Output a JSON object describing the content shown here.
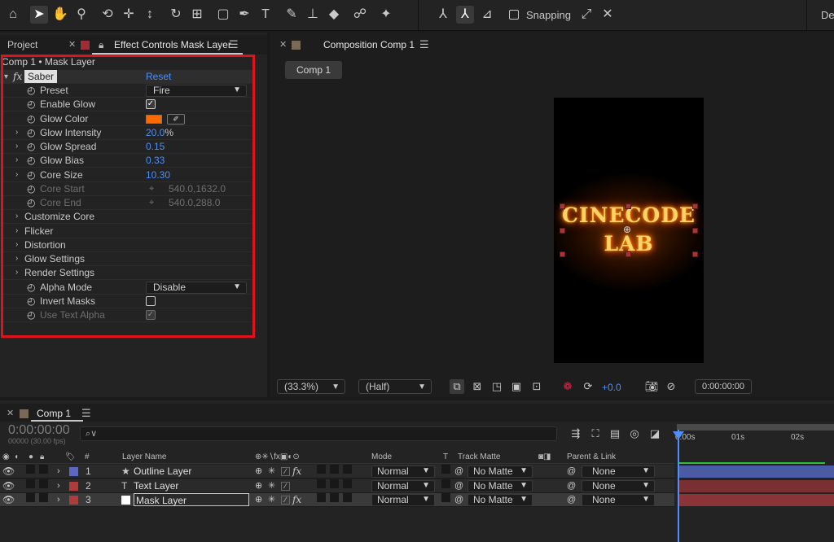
{
  "toolbar": {
    "tools": [
      "home-icon",
      "selection-icon",
      "hand-icon",
      "zoom-icon",
      "orbit-camera-icon",
      "pan-camera-icon",
      "dolly-camera-icon",
      "rotation-icon",
      "anchor-point-icon",
      "rectangle-icon",
      "pen-icon",
      "type-icon",
      "brush-icon",
      "clone-stamp-icon",
      "eraser-icon",
      "roto-brush-icon",
      "puppet-pin-icon"
    ],
    "snapping_label": "Snapping",
    "workspace_label": "De"
  },
  "effect_controls": {
    "tab_project": "Project",
    "tab_effect": "Effect Controls Mask Layer",
    "layer_path": "Comp 1 • Mask Layer",
    "effect_name": "Saber",
    "reset": "Reset",
    "fx": "fx",
    "properties": [
      {
        "name": "Preset",
        "kind": "dropdown",
        "value": "Fire"
      },
      {
        "name": "Enable Glow",
        "kind": "checkbox",
        "value": "✓"
      },
      {
        "name": "Glow Color",
        "kind": "color",
        "value": "#ff6a00"
      },
      {
        "name": "Glow Intensity",
        "kind": "number",
        "value": "20.0",
        "suffix": "%"
      },
      {
        "name": "Glow Spread",
        "kind": "number",
        "value": "0.15"
      },
      {
        "name": "Glow Bias",
        "kind": "number",
        "value": "0.33"
      },
      {
        "name": "Core Size",
        "kind": "number",
        "value": "10.30"
      },
      {
        "name": "Core Start",
        "kind": "point",
        "value": "540.0,1632.0"
      },
      {
        "name": "Core End",
        "kind": "point",
        "value": "540.0,288.0"
      },
      {
        "name": "Customize Core",
        "kind": "group"
      },
      {
        "name": "Flicker",
        "kind": "group"
      },
      {
        "name": "Distortion",
        "kind": "group"
      },
      {
        "name": "Glow Settings",
        "kind": "group"
      },
      {
        "name": "Render Settings",
        "kind": "group"
      },
      {
        "name": "Alpha Mode",
        "kind": "dropdown",
        "value": "Disable"
      },
      {
        "name": "Invert Masks",
        "kind": "checkbox",
        "value": ""
      },
      {
        "name": "Use Text Alpha",
        "kind": "checkbox",
        "value": "✓"
      }
    ]
  },
  "composition": {
    "tab": "Composition Comp 1",
    "chip": "Comp 1",
    "text_line1": "CINECODE",
    "text_line2": "LAB",
    "zoom": "(33.3%)",
    "resolution": "(Half)",
    "exposure": "+0.0",
    "time": "0:00:00:00"
  },
  "timeline": {
    "tab": "Comp 1",
    "current_time": "0:00:00:00",
    "fps": "00000 (30.00 fps)",
    "search_placeholder": "⌕∨",
    "columns": {
      "hash": "#",
      "layer_name": "Layer Name",
      "mode": "Mode",
      "t": "T",
      "track_matte": "Track Matte",
      "parent": "Parent & Link"
    },
    "ruler": [
      "0:00s",
      "01s",
      "02s"
    ],
    "layers": [
      {
        "num": "1",
        "name": "Outline Layer",
        "type_icon": "★",
        "color": "#5a68c2",
        "mode": "Normal",
        "matte": "No Matte",
        "parent": "None",
        "bar": "#4a5aa3",
        "fx": "fx"
      },
      {
        "num": "2",
        "name": "Text Layer",
        "type_icon": "T",
        "color": "#b03b3b",
        "mode": "Normal",
        "matte": "No Matte",
        "parent": "None",
        "bar": "#7a2f33",
        "fx": ""
      },
      {
        "num": "3",
        "name": "Mask Layer",
        "type_icon": "",
        "color": "#b03b3b",
        "mode": "Normal",
        "matte": "No Matte",
        "parent": "None",
        "bar": "#8a3438",
        "fx": "fx"
      }
    ]
  }
}
